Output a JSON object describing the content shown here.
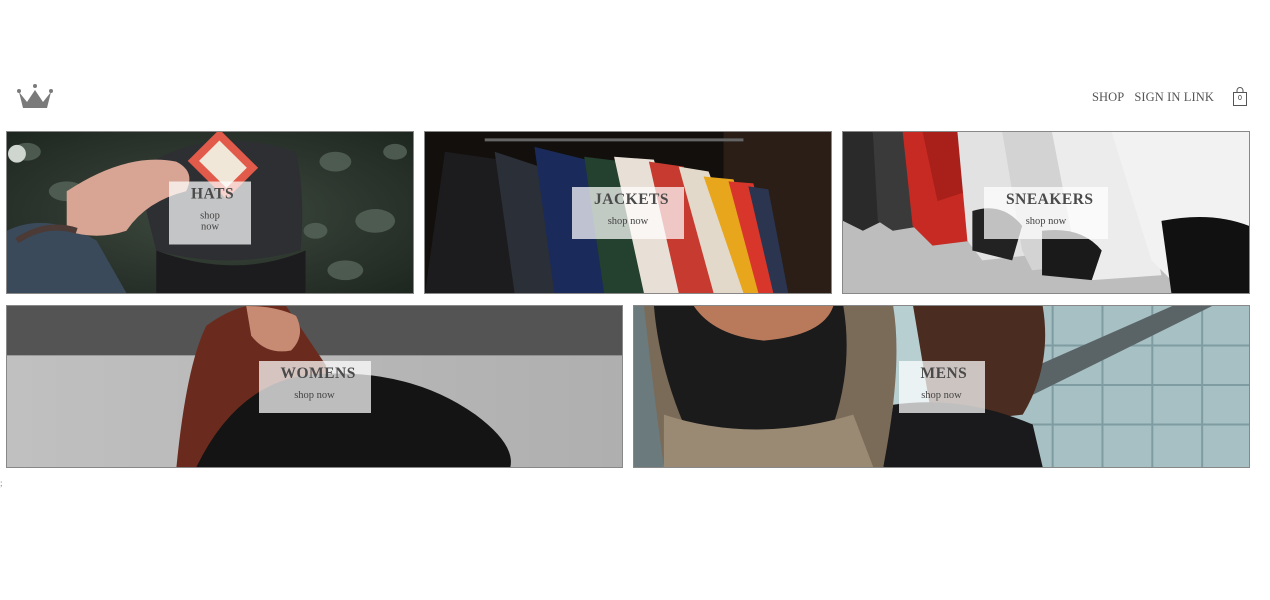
{
  "header": {
    "logo_icon": "crown-icon",
    "nav": {
      "shop": "SHOP",
      "sign_in": "SIGN IN LINK"
    },
    "cart": {
      "icon": "shopping-bag-icon",
      "count": "0"
    }
  },
  "categories": [
    {
      "title": "HATS",
      "cta": "shop now"
    },
    {
      "title": "JACKETS",
      "cta": "shop now"
    },
    {
      "title": "SNEAKERS",
      "cta": "shop now"
    },
    {
      "title": "WOMENS",
      "cta": "shop now"
    },
    {
      "title": "MENS",
      "cta": "shop now"
    }
  ],
  "footer_text": ";"
}
